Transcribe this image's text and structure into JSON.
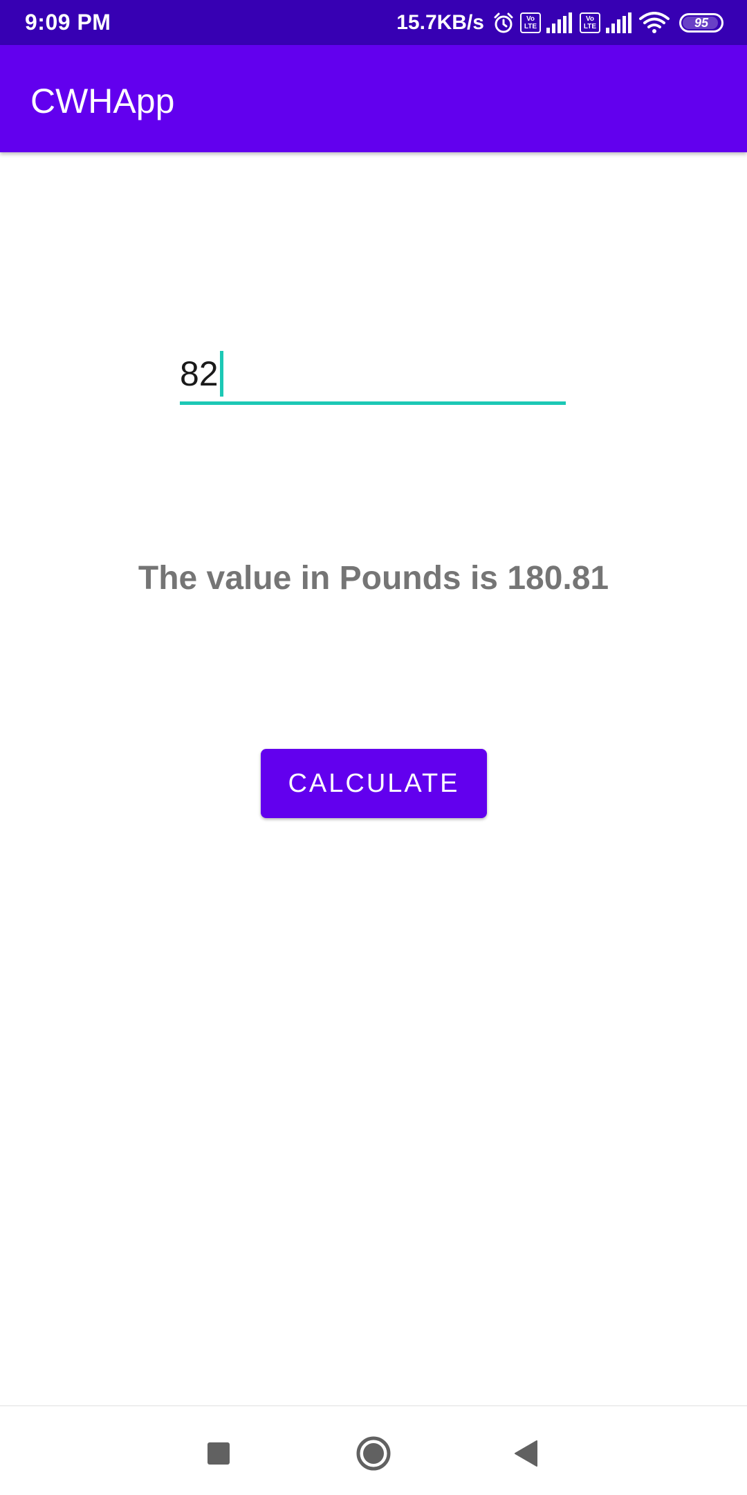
{
  "status_bar": {
    "time": "9:09 PM",
    "net_speed": "15.7KB/s",
    "volte_top": "Vo",
    "volte_bottom": "LTE",
    "battery_level": "95",
    "icons": [
      "alarm-icon",
      "volte-icon",
      "signal-icon",
      "volte-icon",
      "signal-icon",
      "wifi-icon",
      "battery-icon"
    ]
  },
  "app_bar": {
    "title": "CWHApp"
  },
  "main": {
    "input_value": "82",
    "result_text": "The value in Pounds is 180.81",
    "calculate_label": "CALCULATE"
  },
  "nav_bar": {
    "icons": [
      "recents-square-icon",
      "home-circle-icon",
      "back-triangle-icon"
    ]
  },
  "colors": {
    "status_bar": "#3700b3",
    "primary": "#6200ee",
    "accent": "#1cc8b5",
    "result_text": "#757575"
  }
}
